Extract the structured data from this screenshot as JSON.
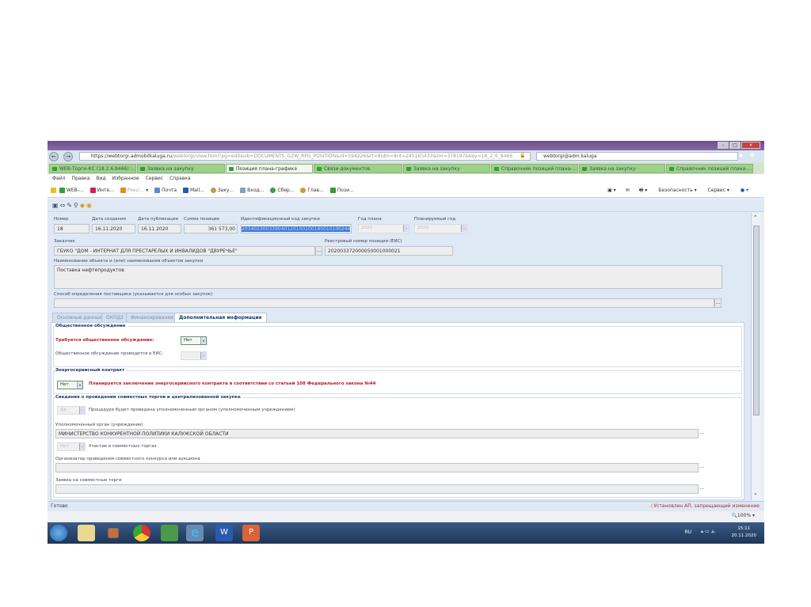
{
  "browser": {
    "url_prefix": "https://",
    "url_host": "webtorgi.admobilkaluga.ru",
    "url_rest": "/webtorgi/view.html?pg=edit&vb=DOCUMENTS_GZW_RPG_POSITION&id=594226&rt=8idm=8rit=245165433&tm=378197&key=18_2_6_8466",
    "search_value": "webtorgi@adm.kaluga",
    "tabs": [
      "WEB-Торги-КС (18.2.6.8466) :...",
      "Заявка на закупку",
      "Позиция плана-графика",
      "Связи документов",
      "Заявка на закупку",
      "Справочник позиций плана-...",
      "Заявка на закупку",
      "Справочник позиций плана-..."
    ],
    "active_tab": 2,
    "menu": [
      "Файл",
      "Правка",
      "Вид",
      "Избранное",
      "Сервис",
      "Справка"
    ],
    "favorites": [
      "WEB-...",
      "Инте...",
      "Peeci...",
      "Почта",
      "Mail...",
      "Заку...",
      "Вход...",
      "Сбер...",
      "Глав...",
      "Пози..."
    ],
    "commands": [
      "Безопасность ▾",
      "Сервис ▾"
    ],
    "status": "Готово",
    "warning": "Установлен АП, запрещающий изменение",
    "zoom": "100%"
  },
  "form": {
    "number": {
      "label": "Номер",
      "value": "18"
    },
    "created": {
      "label": "Дата создания",
      "value": "16.11.2020"
    },
    "published": {
      "label": "Дата публикации",
      "value": "16.11.2020"
    },
    "sum": {
      "label": "Сумма позиции",
      "value": "361 573,00"
    },
    "ikz": {
      "label": "Идентификационный код закупки",
      "value": "203402300339040120100100180010100244"
    },
    "plan_year": {
      "label": "Год плана",
      "value": "2020"
    },
    "planned_year": {
      "label": "Планируемый год",
      "value": "2020"
    },
    "customer": {
      "label": "Заказчик",
      "value": "ГБУКО \"ДОМ - ИНТЕРНАТ ДЛЯ ПРЕСТАРЕЛЫХ И ИНВАЛИДОВ \"ДВУРЕЧЬЕ\""
    },
    "registry": {
      "label": "Реестровый номер позиции (ЕИС)",
      "value": "202003372000050001000021"
    },
    "object_name": {
      "label": "Наименование объекта и (или) наименования объектов закупки",
      "value": "Поставка нефтепродуктов"
    },
    "supplier_method": {
      "label": "Способ определения поставщика (указывается для особых закупок)",
      "value": ""
    },
    "tabs": [
      "Основные данные",
      "ОКПД2",
      "Финансирование",
      "Дополнительная информация"
    ],
    "active_tab": 3
  },
  "public": {
    "title": "Общественное обсуждение",
    "required_label": "Требуется общественное обсуждение:",
    "required_value": "Нет",
    "eis_label": "Общественное обсуждение проводится в ЕИС:",
    "eis_value": ""
  },
  "energy": {
    "title": "Энергосервисный контракт",
    "value": "Нет",
    "text": "Планируется заключение энергосервисного контракта в соответствии со статьей 108 Федерального закона №44"
  },
  "joint": {
    "title": "Сведения о проведении совместных торгов и централизованной закупке",
    "procedure_value": "Да",
    "procedure_label": "Процедура будет проведена уполномоченным органом (уполномоченным учреждением)",
    "authority_label": "Уполномоченный орган (учреждение)",
    "authority_value": "МИНИСТЕРСТВО КОНКУРЕНТНОЙ ПОЛИТИКИ КАЛУЖСКОЙ ОБЛАСТИ",
    "participation_value": "Нет",
    "participation_label": "Участие в совместных торгах",
    "organizer_label": "Организатор проведения совместного конкурса или аукциона",
    "organizer_value": "",
    "request_label": "Заявка на совместные торги",
    "request_value": ""
  },
  "taskbar": {
    "lang": "RU",
    "time": "15:11",
    "date": "20.11.2020",
    "apps": [
      "start",
      "explorer",
      "media-player",
      "chrome",
      "excel-like",
      "internet-explorer",
      "word",
      "powerpoint"
    ]
  }
}
